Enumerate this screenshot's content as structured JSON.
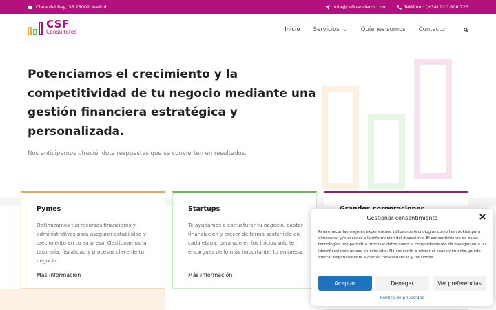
{
  "topbar": {
    "address": "Clara del Rey, 36 28002 Madrid",
    "email": "hola@csfinancieros.com",
    "phone": "Teléfono: (+34) 910 606 723",
    "bg_color": "#b3127e"
  },
  "logo": {
    "brand": "CSF",
    "sub": "Consultores"
  },
  "nav": {
    "items": [
      "Inicio",
      "Servicios",
      "Quiénes somos",
      "Contacto"
    ],
    "active": "Inicio"
  },
  "hero": {
    "title": "Potenciamos el crecimiento y la competitividad de tu negocio mediante una gestión financiera estratégica y personalizada.",
    "lead": "Nos anticipamos ofreciéndote respuestas que se convierten en resultados."
  },
  "cards": [
    {
      "title": "Pymes",
      "text": "Optimizamos tus recursos financieros y administrativos para asegurar estabilidad y crecimiento en tu empresa. Gestionamos la tesorería, fiscalidad y procesos clave de tu negocio.",
      "link": "Más información",
      "color": "#f0a640"
    },
    {
      "title": "Startups",
      "text": "Te ayudamos a estructurar tu negocio, captar financiación y crecer de forma sostenible en cada etapa, para que en los inicios solo te encargues de lo más importante, tu empresa.",
      "link": "Más información",
      "color": "#5ac24a"
    },
    {
      "title": "Grandes corporaciones",
      "text": "",
      "link": "",
      "color": "#b3127e"
    }
  ],
  "consent": {
    "title": "Gestionar consentimiento",
    "body": "Para ofrecer las mejores experiencias, utilizamos tecnologías como las cookies para almacenar y/o acceder a la información del dispositivo. El consentimiento de estas tecnologías nos permitirá procesar datos como el comportamiento de navegación o las identificaciones únicas en este sitio. No consentir o retirar el consentimiento, puede afectar negativamente a ciertas características y funciones.",
    "accept": "Aceptar",
    "deny": "Denegar",
    "prefs": "Ver preferencias",
    "policy": "Política de privacidad",
    "accent": "#1e73be"
  },
  "icons": [
    "map-icon",
    "send-icon",
    "phone-icon",
    "search-icon",
    "chevron-down-icon",
    "close-icon"
  ]
}
